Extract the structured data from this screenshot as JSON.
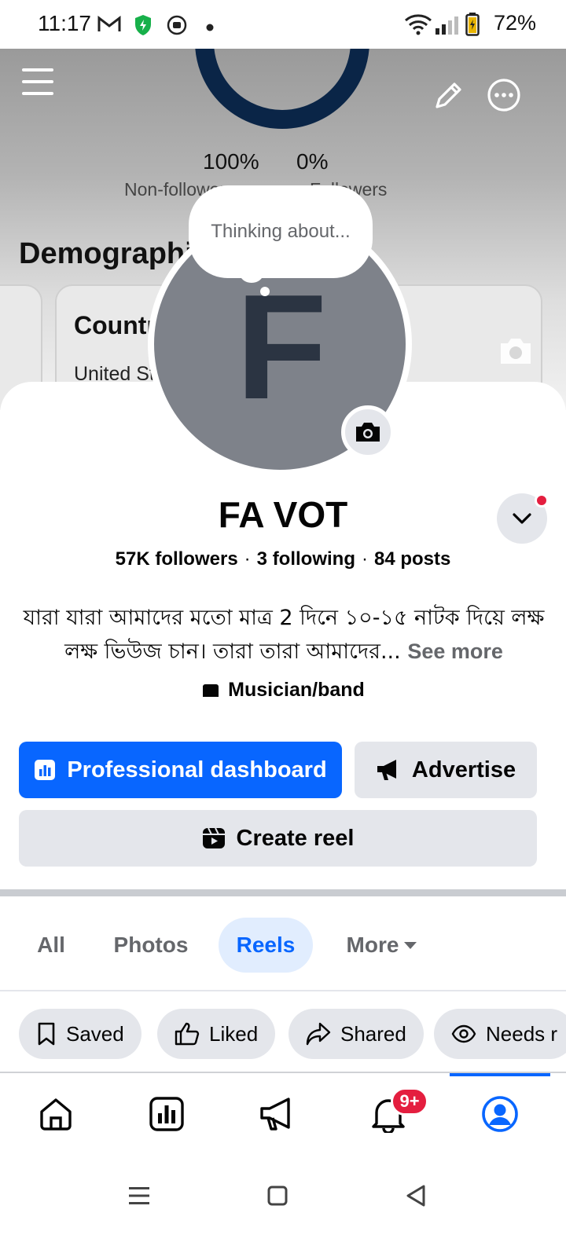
{
  "status_bar": {
    "time": "11:17",
    "battery": "72%",
    "icons": [
      "gmail-icon",
      "shield-icon",
      "media-icon",
      "notification-dot",
      "wifi-icon",
      "signal-icon",
      "battery-icon"
    ]
  },
  "cover": {
    "followers_split": {
      "non_followers_pct": "100%",
      "followers_pct": "0%",
      "non_followers_label": "Non-followers",
      "followers_label": "Followers"
    },
    "demographics_title": "Demographics",
    "country_card": {
      "title": "Country",
      "value": "United States"
    }
  },
  "profile": {
    "avatar_letter": "F",
    "thought_bubble": "Thinking about...",
    "name": "FA VOT",
    "followers": "57K followers",
    "following": "3 following",
    "posts": "84 posts",
    "separator": "·",
    "bio": "যারা যারা আমাদের মতো মাত্র 2 দিনে ১০-১৫ নাটক দিয়ে লক্ষ লক্ষ ভিউজ চান। তারা তারা আমাদের...",
    "see_more": "See more",
    "category": "Musician/band"
  },
  "actions": {
    "professional_dashboard": "Professional dashboard",
    "advertise": "Advertise",
    "create_reel": "Create reel"
  },
  "tabs": [
    {
      "label": "All",
      "active": false
    },
    {
      "label": "Photos",
      "active": false
    },
    {
      "label": "Reels",
      "active": true
    },
    {
      "label": "More",
      "active": false
    }
  ],
  "chips": [
    {
      "label": "Saved",
      "icon": "bookmark-icon"
    },
    {
      "label": "Liked",
      "icon": "thumbs-up-icon"
    },
    {
      "label": "Shared",
      "icon": "share-icon"
    },
    {
      "label": "Needs r",
      "icon": "eye-icon"
    }
  ],
  "bottom_nav": {
    "items": [
      "home",
      "dashboard",
      "advertise",
      "notifications",
      "profile"
    ],
    "notifications_badge": "9+",
    "active": "profile"
  },
  "colors": {
    "accent": "#0866ff",
    "badge": "#e41e3f",
    "button_secondary": "#e4e6eb",
    "text_secondary": "#65676b",
    "chart_ring": "#0a2547"
  }
}
